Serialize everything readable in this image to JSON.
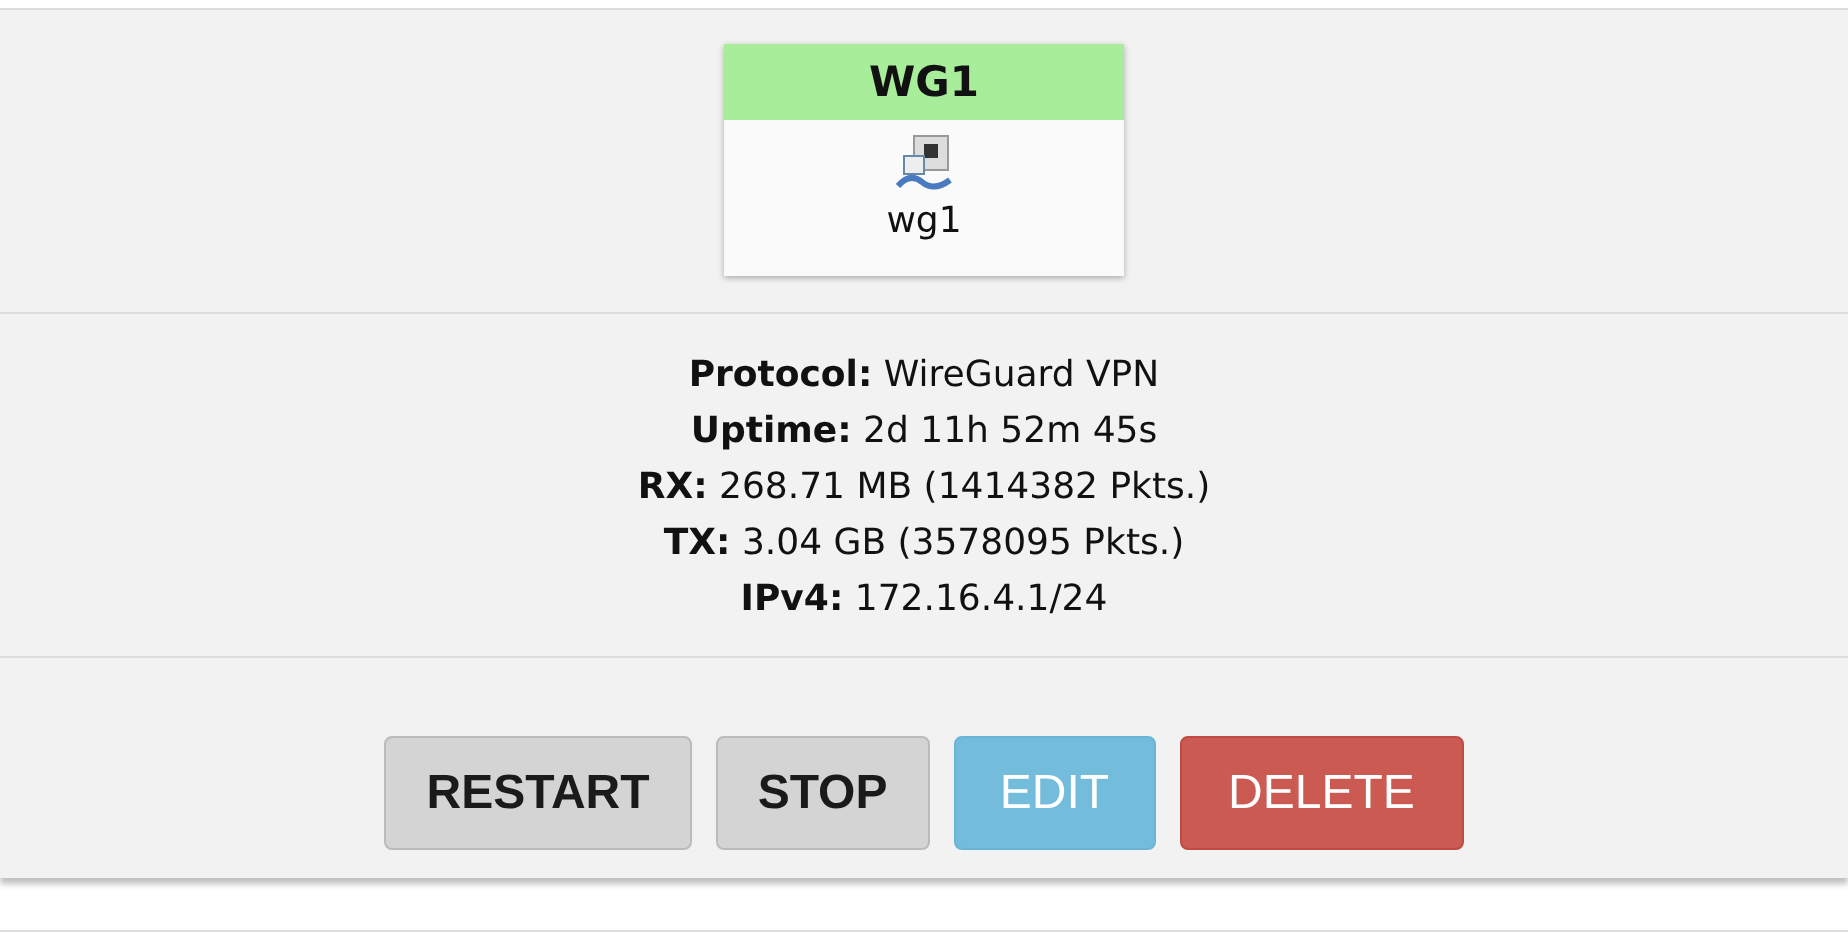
{
  "interface": {
    "title": "WG1",
    "device": "wg1"
  },
  "details": [
    "**Protocol:** WireGuard VPN",
    "**Uptime:** 2d 11h 52m 45s",
    "**RX:** 268.71 MB (1414382 Pkts.)",
    "**TX:** 3.04 GB (3578095 Pkts.)",
    "**IPv4:** 172.16.4.1/24"
  ],
  "buttons": [
    {
      "label": "RESTART",
      "kind": "neutral"
    },
    {
      "label": "STOP",
      "kind": "neutral"
    },
    {
      "label": "EDIT",
      "kind": "edit"
    },
    {
      "label": "DELETE",
      "kind": "danger"
    }
  ]
}
